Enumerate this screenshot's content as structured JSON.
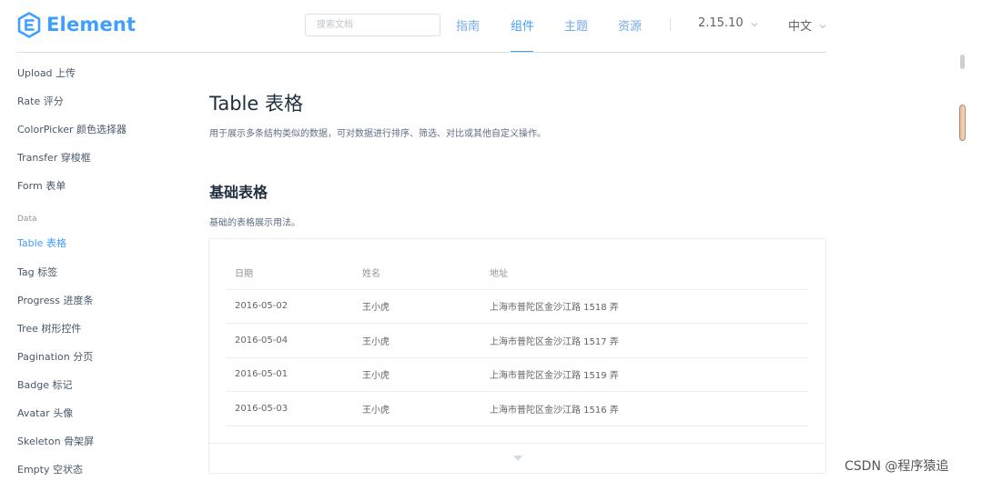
{
  "header": {
    "logo_text": "Element",
    "search_placeholder": "搜索文档",
    "nav": [
      "指南",
      "组件",
      "主题",
      "资源"
    ],
    "active_nav": "组件",
    "version": "2.15.10",
    "language": "中文"
  },
  "sidebar": {
    "items_top": [
      "Upload 上传",
      "Rate 评分",
      "ColorPicker 颜色选择器",
      "Transfer 穿梭框",
      "Form 表单"
    ],
    "group_label": "Data",
    "items_data": [
      "Table 表格",
      "Tag 标签",
      "Progress 进度条",
      "Tree 树形控件",
      "Pagination 分页",
      "Badge 标记",
      "Avatar 头像",
      "Skeleton 骨架屏",
      "Empty 空状态"
    ],
    "active_item": "Table 表格"
  },
  "main": {
    "title": "Table 表格",
    "description": "用于展示多条结构类似的数据，可对数据进行排序、筛选、对比或其他自定义操作。",
    "section_title": "基础表格",
    "section_description": "基础的表格展示用法。",
    "table": {
      "columns": [
        "日期",
        "姓名",
        "地址"
      ],
      "rows": [
        [
          "2016-05-02",
          "王小虎",
          "上海市普陀区金沙江路 1518 弄"
        ],
        [
          "2016-05-04",
          "王小虎",
          "上海市普陀区金沙江路 1517 弄"
        ],
        [
          "2016-05-01",
          "王小虎",
          "上海市普陀区金沙江路 1519 弄"
        ],
        [
          "2016-05-03",
          "王小虎",
          "上海市普陀区金沙江路 1516 弄"
        ]
      ]
    }
  },
  "watermark": "CSDN @程序猿追",
  "colors": {
    "accent": "#409eff",
    "nav_inactive": "#73a9e6",
    "text_primary": "#1f2f3d",
    "text_secondary": "#5e6d82"
  }
}
